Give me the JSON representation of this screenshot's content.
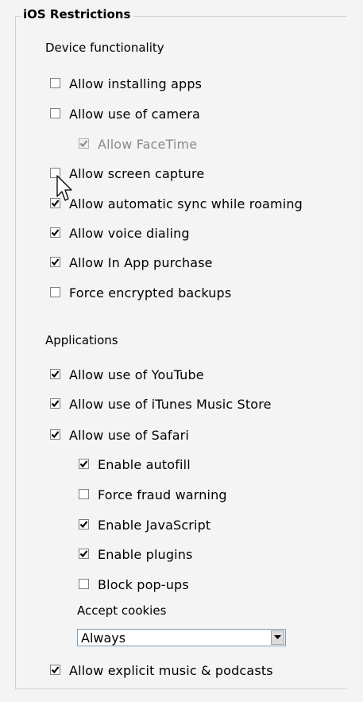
{
  "group": {
    "title": "iOS Restrictions"
  },
  "device_section": {
    "label": "Device functionality",
    "items": [
      {
        "label": "Allow installing apps",
        "checked": false,
        "disabled": false
      },
      {
        "label": "Allow use of camera",
        "checked": false,
        "disabled": false
      },
      {
        "label": "Allow FaceTime",
        "checked": true,
        "disabled": true
      },
      {
        "label": "Allow screen capture",
        "checked": false,
        "disabled": false
      },
      {
        "label": "Allow automatic sync while roaming",
        "checked": true,
        "disabled": false
      },
      {
        "label": "Allow voice dialing",
        "checked": true,
        "disabled": false
      },
      {
        "label": "Allow In App purchase",
        "checked": true,
        "disabled": false
      },
      {
        "label": "Force encrypted backups",
        "checked": false,
        "disabled": false
      }
    ]
  },
  "applications_section": {
    "label": "Applications",
    "items": [
      {
        "label": "Allow use of YouTube",
        "checked": true
      },
      {
        "label": "Allow use of iTunes Music Store",
        "checked": true
      },
      {
        "label": "Allow use of Safari",
        "checked": true
      }
    ],
    "safari_items": [
      {
        "label": "Enable autofill",
        "checked": true
      },
      {
        "label": "Force fraud warning",
        "checked": false
      },
      {
        "label": "Enable JavaScript",
        "checked": true
      },
      {
        "label": "Enable plugins",
        "checked": true
      },
      {
        "label": "Block pop-ups",
        "checked": false
      }
    ],
    "cookies": {
      "label": "Accept cookies",
      "value": "Always"
    },
    "explicit": {
      "label": "Allow explicit music & podcasts",
      "checked": true
    }
  },
  "colors": {
    "check": "#000000",
    "check_disabled": "#8a8a8a",
    "panel": "#f4f4f4"
  }
}
